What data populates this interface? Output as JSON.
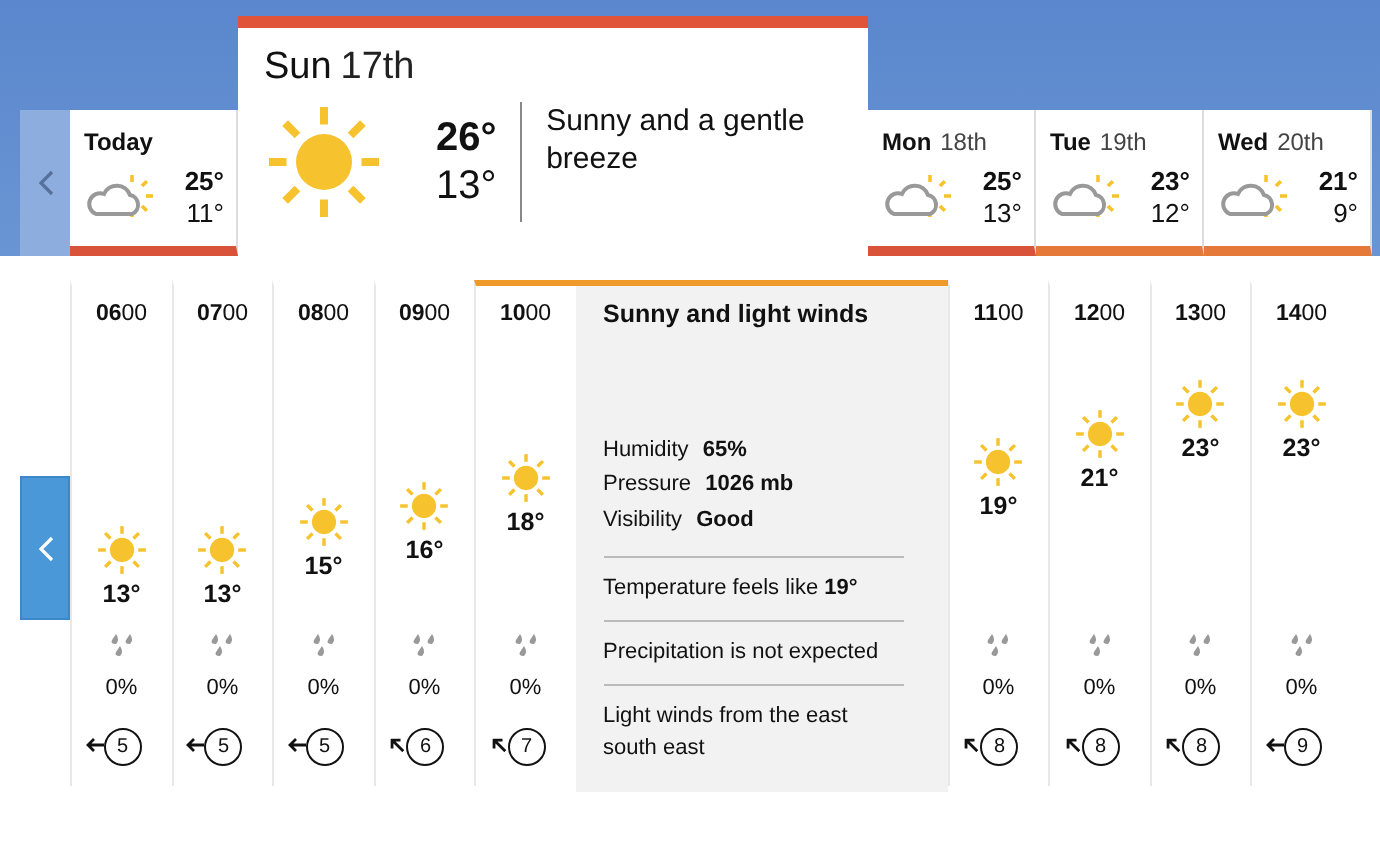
{
  "days": [
    {
      "day": "Today",
      "max": "25°",
      "min": "11°",
      "kind": "sunny_intervals",
      "color": "#d9533a",
      "selected": false
    },
    {
      "day": "Sun",
      "date": "17th",
      "max": "26°",
      "min": "13°",
      "kind": "sunny",
      "color": "#e0553a",
      "description": "Sunny and a gentle breeze",
      "selected": true
    },
    {
      "day": "Mon",
      "date": "18th",
      "max": "25°",
      "min": "13°",
      "kind": "sunny_intervals",
      "color": "#d9533a",
      "selected": false
    },
    {
      "day": "Tue",
      "date": "19th",
      "max": "23°",
      "min": "12°",
      "kind": "sunny_intervals",
      "color": "#e5793a",
      "selected": false
    },
    {
      "day": "Wed",
      "date": "20th",
      "max": "21°",
      "min": "9°",
      "kind": "sunny_intervals",
      "color": "#e5793a",
      "selected": false
    }
  ],
  "hours": [
    {
      "time": "**06**00",
      "kind": "sunny",
      "temp": "13°",
      "precip": "0%",
      "wind": {
        "speed": "5",
        "kind": "left"
      },
      "selected": false
    },
    {
      "time": "**07**00",
      "kind": "sunny",
      "temp": "13°",
      "precip": "0%",
      "wind": {
        "speed": "5",
        "kind": "left"
      },
      "selected": false
    },
    {
      "time": "**08**00",
      "kind": "sunny",
      "temp": "15°",
      "precip": "0%",
      "wind": {
        "speed": "5",
        "kind": "left"
      },
      "selected": false
    },
    {
      "time": "**09**00",
      "kind": "sunny",
      "temp": "16°",
      "precip": "0%",
      "wind": {
        "speed": "6",
        "kind": "upleft"
      },
      "selected": false
    },
    {
      "time": "**10**00",
      "kind": "sunny",
      "temp": "18°",
      "precip": "0%",
      "wind": {
        "speed": "7",
        "kind": "upleft"
      },
      "selected": true,
      "detail": {
        "title": "Sunny and light winds",
        "stats": [
          {
            "label": "Humidity",
            "value": "65%"
          },
          {
            "label": "Pressure",
            "value": "1026 mb"
          },
          {
            "label": "Visibility",
            "value": "Good"
          }
        ],
        "notes": [
          "Temperature feels like **19°**",
          "Precipitation is not expected",
          "Light winds from the east south east"
        ]
      }
    },
    {
      "time": "**11**00",
      "kind": "sunny",
      "temp": "19°",
      "precip": "0%",
      "wind": {
        "speed": "8",
        "kind": "upleft"
      },
      "selected": false
    },
    {
      "time": "**12**00",
      "kind": "sunny",
      "temp": "21°",
      "precip": "0%",
      "wind": {
        "speed": "8",
        "kind": "upleft"
      },
      "selected": false
    },
    {
      "time": "**13**00",
      "kind": "sunny",
      "temp": "23°",
      "precip": "0%",
      "wind": {
        "speed": "8",
        "kind": "upleft"
      },
      "selected": false
    },
    {
      "time": "**14**00",
      "kind": "sunny",
      "temp": "23°",
      "precip": "0%",
      "wind": {
        "speed": "9",
        "kind": "left"
      },
      "selected": false
    }
  ]
}
